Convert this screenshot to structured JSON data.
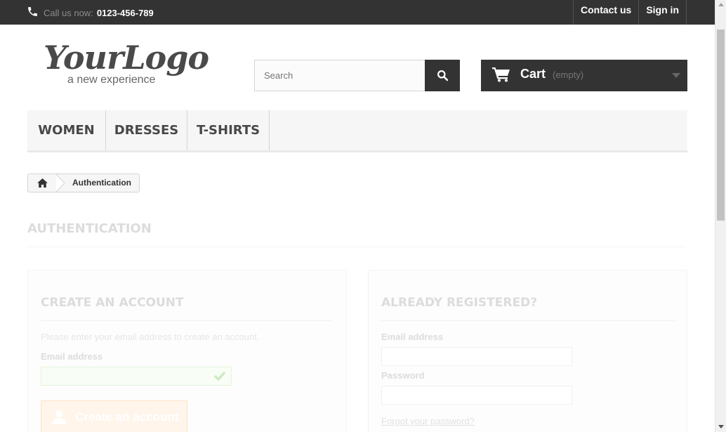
{
  "topbar": {
    "phone_label": "Call us now:",
    "phone_number": "0123-456-789",
    "links": [
      "Contact us",
      "Sign in"
    ]
  },
  "logo": {
    "title": "YourLogo",
    "tagline": "a new experience"
  },
  "search": {
    "placeholder": "Search"
  },
  "cart": {
    "label": "Cart",
    "status": "(empty)"
  },
  "menu": {
    "items": [
      "WOMEN",
      "DRESSES",
      "T-SHIRTS"
    ]
  },
  "breadcrumb": {
    "current": "Authentication"
  },
  "page_heading": "AUTHENTICATION",
  "create_account": {
    "heading": "CREATE AN ACCOUNT",
    "description": "Please enter your email address to create an account.",
    "email_label": "Email address",
    "email_value": "",
    "button_label": "Create an account"
  },
  "login": {
    "heading": "ALREADY REGISTERED?",
    "email_label": "Email address",
    "email_value": "",
    "password_label": "Password",
    "password_value": "",
    "forgot_link": "Forgot your password?"
  },
  "icons": [
    "phone-icon",
    "search-icon",
    "cart-icon",
    "caret-down-icon",
    "home-icon",
    "check-icon",
    "user-icon"
  ]
}
